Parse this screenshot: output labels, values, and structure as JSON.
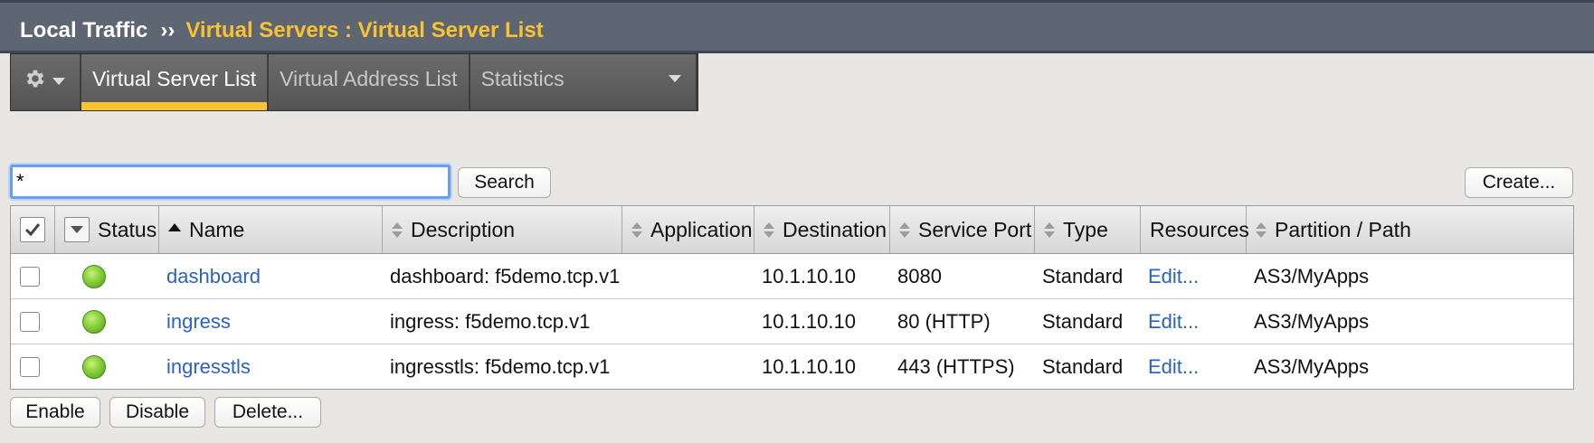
{
  "breadcrumb": {
    "root": "Local Traffic",
    "separator": "››",
    "current": "Virtual Servers : Virtual Server List"
  },
  "tabs": [
    {
      "label": "Virtual Server List",
      "active": true
    },
    {
      "label": "Virtual Address List",
      "active": false
    },
    {
      "label": "Statistics",
      "active": false
    }
  ],
  "search": {
    "value": "*",
    "button_label": "Search"
  },
  "create_label": "Create...",
  "table": {
    "columns": [
      "Status",
      "Name",
      "Description",
      "Application",
      "Destination",
      "Service Port",
      "Type",
      "Resources",
      "Partition / Path"
    ],
    "rows": [
      {
        "name": "dashboard",
        "description": "dashboard: f5demo.tcp.v1",
        "application": "",
        "destination": "10.1.10.10",
        "service_port": "8080",
        "type": "Standard",
        "resources": "Edit...",
        "partition": "AS3/MyApps"
      },
      {
        "name": "ingress",
        "description": "ingress: f5demo.tcp.v1",
        "application": "",
        "destination": "10.1.10.10",
        "service_port": "80 (HTTP)",
        "type": "Standard",
        "resources": "Edit...",
        "partition": "AS3/MyApps"
      },
      {
        "name": "ingresstls",
        "description": "ingresstls: f5demo.tcp.v1",
        "application": "",
        "destination": "10.1.10.10",
        "service_port": "443 (HTTPS)",
        "type": "Standard",
        "resources": "Edit...",
        "partition": "AS3/MyApps"
      }
    ]
  },
  "actions": {
    "enable": "Enable",
    "disable": "Disable",
    "delete": "Delete..."
  },
  "colors": {
    "accent": "#f8c232",
    "link": "#2a62c4",
    "status_ok": "#86cf3a",
    "titlebar": "#5e6673"
  },
  "icons": {
    "gear": "gear-icon",
    "status": "status-available-icon"
  }
}
